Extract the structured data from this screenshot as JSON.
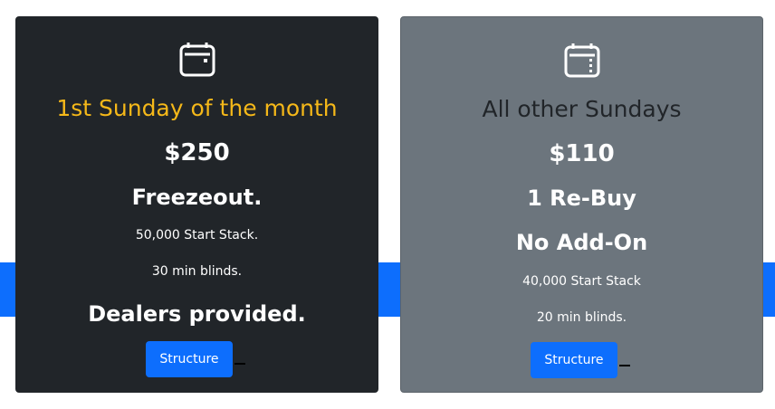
{
  "colors": {
    "accent_yellow": "#f5b819",
    "band_blue": "#0d6efd",
    "dark_card": "#212529",
    "gray_card": "#6c757d",
    "title_dark_text": "#212529"
  },
  "cards": [
    {
      "icon": "calendar-icon",
      "title": "1st Sunday of the month",
      "price": "$250",
      "lines": [
        "Freezeout.",
        "50,000 Start Stack.",
        "30 min blinds.",
        "Dealers provided."
      ],
      "button_label": "Structure"
    },
    {
      "icon": "calendar-icon",
      "title": "All other Sundays",
      "price": "$110",
      "lines": [
        "1 Re-Buy",
        "No Add-On",
        "40,000 Start Stack",
        "20 min blinds."
      ],
      "button_label": "Structure"
    }
  ]
}
